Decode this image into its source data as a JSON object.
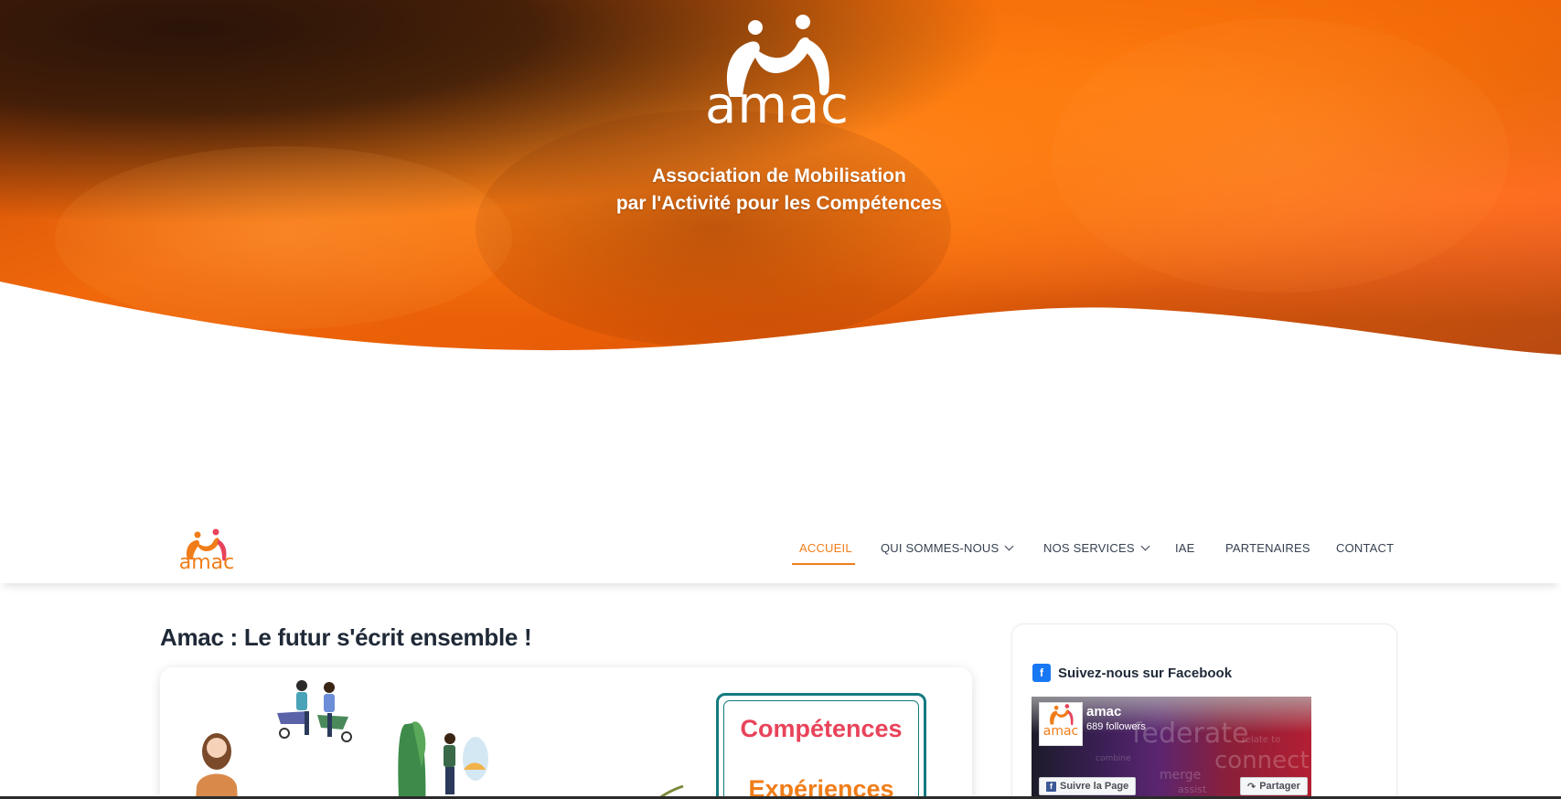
{
  "hero": {
    "logo_text": "amac",
    "tagline_line1": "Association de Mobilisation",
    "tagline_line2": "par l'Activité pour les Compétences"
  },
  "navbar": {
    "logo_text": "amac",
    "items": [
      {
        "label": "ACCUEIL",
        "active": true,
        "has_dropdown": false
      },
      {
        "label": "QUI SOMMES-NOUS",
        "active": false,
        "has_dropdown": true
      },
      {
        "label": "NOS SERVICES",
        "active": false,
        "has_dropdown": true
      },
      {
        "label": "IAE",
        "active": false,
        "has_dropdown": false
      },
      {
        "label": "PARTENAIRES",
        "active": false,
        "has_dropdown": false
      },
      {
        "label": "CONTACT",
        "active": false,
        "has_dropdown": false
      }
    ]
  },
  "main": {
    "title": "Amac : Le futur s'écrit ensemble !",
    "feature": {
      "word1": "Compétences",
      "word2": "Expériences"
    }
  },
  "sidebar": {
    "facebook": {
      "icon": "f",
      "heading": "Suivez-nous sur Facebook",
      "page_name": "amac",
      "avatar_text": "amac",
      "followers": "689 followers",
      "follow_label": "Suivre la Page",
      "share_label": "Partager"
    }
  },
  "colors": {
    "brand_orange": "#f07d19",
    "brand_red": "#e8435a",
    "teal": "#137a7f",
    "facebook_blue": "#1877f2"
  }
}
